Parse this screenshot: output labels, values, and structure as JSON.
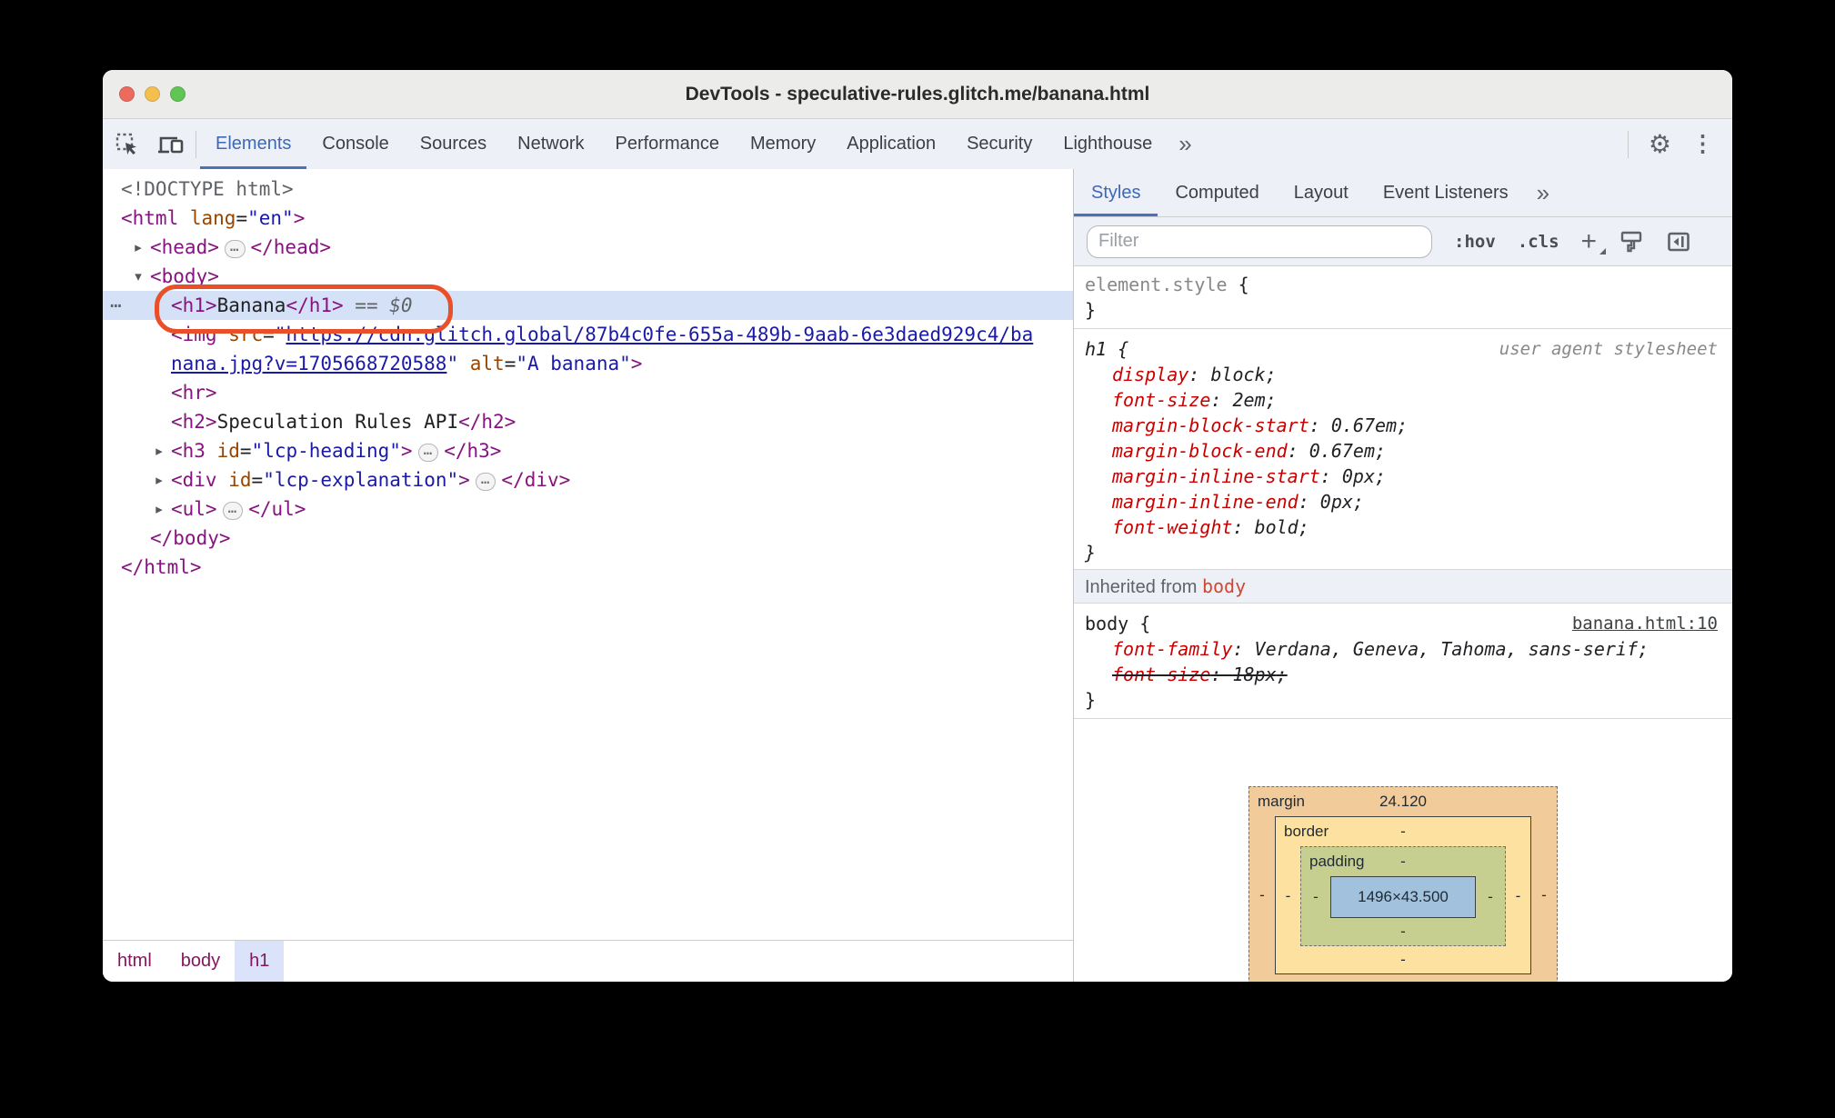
{
  "window_title": "DevTools - speculative-rules.glitch.me/banana.html",
  "toolbar": {
    "tabs": [
      {
        "label": "Elements",
        "selected": true
      },
      {
        "label": "Console"
      },
      {
        "label": "Sources"
      },
      {
        "label": "Network"
      },
      {
        "label": "Performance"
      },
      {
        "label": "Memory"
      },
      {
        "label": "Application"
      },
      {
        "label": "Security"
      },
      {
        "label": "Lighthouse"
      }
    ],
    "more_tabs": "»"
  },
  "icons": {
    "collapsed": "▸",
    "expanded": "▾",
    "inline_ellipsis": "…",
    "gutter_ellipsis": "⋯",
    "settings": "⚙",
    "menu": "⋮",
    "more": "»"
  },
  "dom_tree": {
    "lines": [
      {
        "indent": 20,
        "tokens": [
          [
            "gray",
            "<!DOCTYPE html>"
          ]
        ]
      },
      {
        "indent": 20,
        "tokens": [
          [
            "tag",
            "<html"
          ],
          [
            "plain",
            " "
          ],
          [
            "attr",
            "lang"
          ],
          [
            "plain",
            "="
          ],
          [
            "val",
            "\"en\""
          ],
          [
            "tag",
            ">"
          ]
        ]
      },
      {
        "indent": 52,
        "arrow": "collapsed",
        "tokens": [
          [
            "tag",
            "<head>"
          ],
          [
            "badge",
            ""
          ],
          [
            "tag",
            "</head>"
          ]
        ]
      },
      {
        "indent": 52,
        "arrow": "expanded",
        "tokens": [
          [
            "tag",
            "<body>"
          ]
        ]
      },
      {
        "indent": 75,
        "selected": true,
        "gutter": true,
        "ring": true,
        "tokens": [
          [
            "tag",
            "<h1>"
          ],
          [
            "plain",
            "Banana"
          ],
          [
            "tag",
            "</h1>"
          ],
          [
            "gray",
            " == "
          ],
          [
            "grayi",
            "$0"
          ]
        ]
      },
      {
        "indent": 75,
        "tokens": [
          [
            "tag",
            "<img"
          ],
          [
            "plain",
            " "
          ],
          [
            "attr",
            "src"
          ],
          [
            "plain",
            "="
          ],
          [
            "val",
            "\""
          ],
          [
            "link",
            "https://cdn.glitch.global/87b4c0fe-655a-489b-9aab-6e3daed929c4/ba"
          ]
        ]
      },
      {
        "indent": 75,
        "tokens": [
          [
            "link",
            "nana.jpg?v=1705668720588"
          ],
          [
            "val",
            "\""
          ],
          [
            "plain",
            " "
          ],
          [
            "attr",
            "alt"
          ],
          [
            "plain",
            "="
          ],
          [
            "val",
            "\"A banana\""
          ],
          [
            "tag",
            ">"
          ]
        ]
      },
      {
        "indent": 75,
        "tokens": [
          [
            "tag",
            "<hr>"
          ]
        ]
      },
      {
        "indent": 75,
        "tokens": [
          [
            "tag",
            "<h2>"
          ],
          [
            "plain",
            "Speculation Rules API"
          ],
          [
            "tag",
            "</h2>"
          ]
        ]
      },
      {
        "indent": 75,
        "arrow": "collapsed",
        "tokens": [
          [
            "tag",
            "<h3"
          ],
          [
            "plain",
            " "
          ],
          [
            "attr",
            "id"
          ],
          [
            "plain",
            "="
          ],
          [
            "val",
            "\"lcp-heading\""
          ],
          [
            "tag",
            ">"
          ],
          [
            "badge",
            ""
          ],
          [
            "tag",
            "</h3>"
          ]
        ]
      },
      {
        "indent": 75,
        "arrow": "collapsed",
        "tokens": [
          [
            "tag",
            "<div"
          ],
          [
            "plain",
            " "
          ],
          [
            "attr",
            "id"
          ],
          [
            "plain",
            "="
          ],
          [
            "val",
            "\"lcp-explanation\""
          ],
          [
            "tag",
            ">"
          ],
          [
            "badge",
            ""
          ],
          [
            "tag",
            "</div>"
          ]
        ]
      },
      {
        "indent": 75,
        "arrow": "collapsed",
        "tokens": [
          [
            "tag",
            "<ul>"
          ],
          [
            "badge",
            ""
          ],
          [
            "tag",
            "</ul>"
          ]
        ]
      },
      {
        "indent": 52,
        "tokens": [
          [
            "tag",
            "</body>"
          ]
        ]
      },
      {
        "indent": 20,
        "tokens": [
          [
            "tag",
            "</html>"
          ]
        ]
      }
    ]
  },
  "breadcrumb": {
    "items": [
      {
        "label": "html"
      },
      {
        "label": "body"
      },
      {
        "label": "h1",
        "active": true
      }
    ]
  },
  "sidebar": {
    "tabs": [
      {
        "label": "Styles",
        "selected": true
      },
      {
        "label": "Computed"
      },
      {
        "label": "Layout"
      },
      {
        "label": "Event Listeners"
      }
    ],
    "more_tabs": "»",
    "filter_placeholder": "Filter",
    "pseudo_toggle": ":hov",
    "class_toggle": ".cls"
  },
  "styles": {
    "punct": {
      "colon": ": ",
      "semi": ";",
      "open": "{",
      "close": "}"
    },
    "element_style": {
      "selector": "element.style",
      "open": "{",
      "close": "}"
    },
    "rules": [
      {
        "id": "h1",
        "selector": "h1",
        "origin": "user agent stylesheet",
        "declarations": [
          [
            "display",
            "block"
          ],
          [
            "font-size",
            "2em"
          ],
          [
            "margin-block-start",
            "0.67em"
          ],
          [
            "margin-block-end",
            "0.67em"
          ],
          [
            "margin-inline-start",
            "0px"
          ],
          [
            "margin-inline-end",
            "0px"
          ],
          [
            "font-weight",
            "bold"
          ]
        ]
      },
      {
        "id": "body",
        "selector": "body",
        "source": "banana.html:10",
        "declarations": [
          [
            "font-family",
            "Verdana, Geneva, Tahoma, sans-serif"
          ],
          [
            "font-size",
            "18px",
            "overridden"
          ]
        ]
      }
    ],
    "inherited_prefix": "Inherited from ",
    "inherited_node": "body"
  },
  "box_model": {
    "margin": {
      "label": "margin",
      "top": "24.120",
      "left": "-",
      "right": "-",
      "bottom": "-"
    },
    "border": {
      "label": "border",
      "top": "-",
      "left": "-",
      "right": "-",
      "bottom": "-"
    },
    "padding": {
      "label": "padding",
      "top": "-",
      "left": "-",
      "right": "-",
      "bottom": "-"
    },
    "content": "1496×43.500"
  },
  "colors": {
    "accent_blue": "#3d68b5",
    "tab_underline": "#4a72b8",
    "selection_bg": "#d5e1f7",
    "annotation_ring": "#e8502a",
    "tag": "#881280",
    "attr_name": "#994500",
    "attr_value": "#1a1aa6",
    "css_property": "#c80000",
    "traffic_close": "#ed6a5e",
    "traffic_minimize": "#f4bf4f",
    "traffic_zoom": "#61c454",
    "margin_bg": "#f2cb9b",
    "border_bg": "#fce1a0",
    "padding_bg": "#c6cf90",
    "content_bg": "#a2c1dc"
  }
}
